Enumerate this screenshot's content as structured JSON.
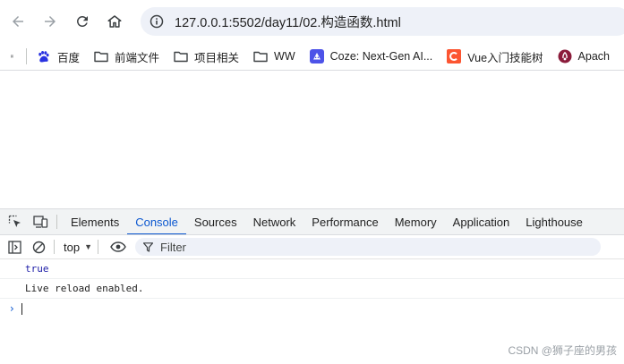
{
  "browser": {
    "url": "127.0.0.1:5502/day11/02.构造函数.html"
  },
  "bookmarks": [
    {
      "label": "百度",
      "icon": "paw-icon"
    },
    {
      "label": "前端文件",
      "icon": "folder-icon"
    },
    {
      "label": "项目相关",
      "icon": "folder-icon"
    },
    {
      "label": "WW",
      "icon": "folder-icon"
    },
    {
      "label": "Coze: Next-Gen AI...",
      "icon": "coze-icon"
    },
    {
      "label": "Vue入门技能树",
      "icon": "csdn-icon"
    },
    {
      "label": "Apach",
      "icon": "apache-icon"
    }
  ],
  "devtools": {
    "tabs": [
      "Elements",
      "Console",
      "Sources",
      "Network",
      "Performance",
      "Memory",
      "Application",
      "Lighthouse"
    ],
    "active_tab": "Console",
    "context": "top",
    "filter_placeholder": "Filter"
  },
  "console": {
    "lines": [
      {
        "text": "true",
        "kind": "value"
      },
      {
        "text": "Live reload enabled.",
        "kind": "text"
      }
    ],
    "prompt": "›"
  },
  "watermark": "CSDN @狮子座的男孩",
  "colors": {
    "accent": "#0b57d0",
    "value_blue": "#1a1aa6"
  }
}
